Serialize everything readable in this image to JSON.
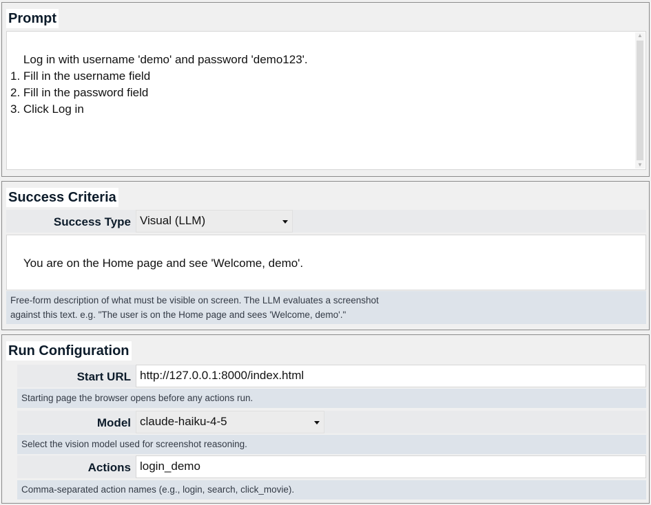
{
  "prompt": {
    "title": "Prompt",
    "text": "Log in with username 'demo' and password 'demo123'.\n1. Fill in the username field\n2. Fill in the password field\n3. Click Log in"
  },
  "success": {
    "title": "Success Criteria",
    "type_label": "Success Type",
    "type_value": "Visual (LLM)",
    "criteria_text": "You are on the Home page and see 'Welcome, demo'.",
    "hint_line1": "Free-form description of what must be visible on screen. The LLM evaluates a screenshot",
    "hint_line2": "against this text. e.g. \"The user is on the Home page and sees 'Welcome, demo'.\""
  },
  "run": {
    "title": "Run Configuration",
    "start_url_label": "Start URL",
    "start_url_value": "http://127.0.0.1:8000/index.html",
    "start_url_hint": "Starting page the browser opens before any actions run.",
    "model_label": "Model",
    "model_value": "claude-haiku-4-5",
    "model_hint": "Select the vision model used for screenshot reasoning.",
    "actions_label": "Actions",
    "actions_value": "login_demo",
    "actions_hint": "Comma-separated action names (e.g., login, search, click_movie)."
  }
}
